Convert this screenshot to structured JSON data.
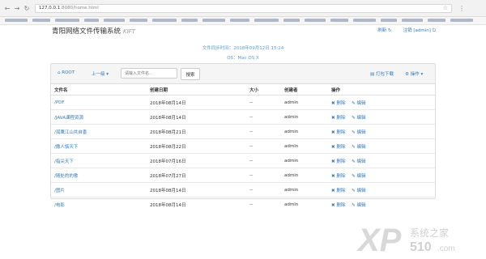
{
  "browser": {
    "url_host": "127.0.0.1",
    "url_path": ":8080/home.html",
    "nav_icons": [
      "back-icon",
      "forward-icon",
      "reload-icon"
    ]
  },
  "app": {
    "title": "青阳网络文件传输系统",
    "title_suffix": "KIFT",
    "refresh_label": "刷新",
    "logout_label": "注销 [admin]"
  },
  "info": {
    "sync_time": "文件同步时间：2018年09月12日 15:24",
    "os": "OS：Mac OS X"
  },
  "toolbar": {
    "root_label": "ROOT",
    "up_label": "上一级",
    "search_placeholder": "请输入文件名...",
    "search_button": "搜索",
    "pack_download": "打包下载",
    "operations": "操作"
  },
  "table": {
    "headers": [
      "文件名",
      "创建日期",
      "大小",
      "创建者",
      "操作"
    ],
    "rows": [
      {
        "name": "/PDF",
        "date": "2018年08月14日",
        "size": "--",
        "creator": "admin"
      },
      {
        "name": "/JAVA课程资源",
        "date": "2018年08月14日",
        "size": "--",
        "creator": "admin"
      },
      {
        "name": "/孤鹰江山共自香",
        "date": "2018年08月21日",
        "size": "--",
        "creator": "admin"
      },
      {
        "name": "/撒人惦天下",
        "date": "2018年08月22日",
        "size": "--",
        "creator": "admin"
      },
      {
        "name": "/指尖天下",
        "date": "2018年07月16日",
        "size": "--",
        "creator": "admin"
      },
      {
        "name": "/随处的的歌",
        "date": "2018年07月27日",
        "size": "--",
        "creator": "admin"
      },
      {
        "name": "/图片",
        "date": "2018年08月14日",
        "size": "--",
        "creator": "admin"
      },
      {
        "name": "/电影",
        "date": "2018年08月14日",
        "size": "--",
        "creator": "admin"
      }
    ],
    "delete_label": "删除",
    "edit_label": "编辑"
  },
  "watermark": {
    "brand": "XP",
    "number": "510",
    "cn": "系统之家",
    "domain": ".com"
  },
  "colors": {
    "link": "#337ab7",
    "info": "#5b9bd5",
    "toolbar_bg": "#f5f5f5",
    "chrome_bg": "#f2f2f2"
  }
}
